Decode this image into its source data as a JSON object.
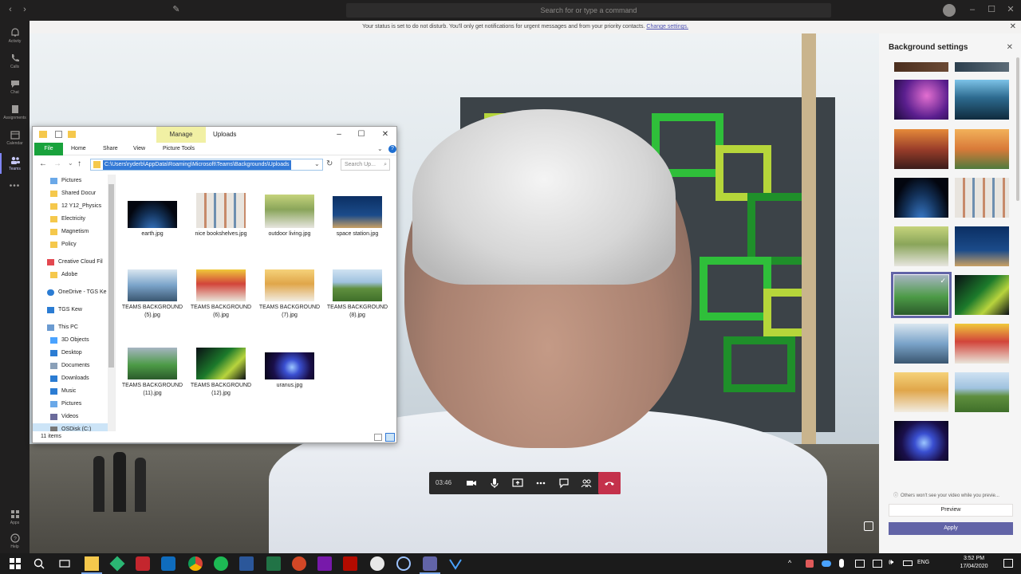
{
  "teams": {
    "search_placeholder": "Search for or type a command",
    "banner_text": "Your status is set to do not disturb. You'll only get notifications for urgent messages and from your priority contacts. ",
    "banner_link": "Change settings.",
    "rail": [
      {
        "label": "Activity",
        "icon": "bell-icon"
      },
      {
        "label": "Calls",
        "icon": "phone-icon"
      },
      {
        "label": "Chat",
        "icon": "chat-icon"
      },
      {
        "label": "Assignments",
        "icon": "assignments-icon"
      },
      {
        "label": "Calendar",
        "icon": "calendar-icon"
      },
      {
        "label": "Teams",
        "icon": "teams-icon"
      },
      {
        "label": "...",
        "icon": "more-icon"
      },
      {
        "label": "Apps",
        "icon": "apps-icon"
      },
      {
        "label": "Help",
        "icon": "help-icon"
      }
    ]
  },
  "call": {
    "timer": "03:46"
  },
  "bg_panel": {
    "title": "Background settings",
    "note": "Others won't see your video while you previe...",
    "preview_label": "Preview",
    "apply_label": "Apply",
    "accent": "#6264a7"
  },
  "explorer": {
    "manage_tab": "Manage",
    "window_title": "Uploads",
    "ribbon": {
      "file": "File",
      "home": "Home",
      "share": "Share",
      "view": "View",
      "picture_tools": "Picture Tools"
    },
    "address": "C:\\Users\\ryderb\\AppData\\Roaming\\Microsoft\\Teams\\Backgrounds\\Uploads",
    "search_placeholder": "Search Up...",
    "nav": [
      {
        "label": "Pictures",
        "type": "pictures"
      },
      {
        "label": "Shared Docur",
        "type": "folder"
      },
      {
        "label": "12 Y12_Physics",
        "type": "folder"
      },
      {
        "label": "Electricity",
        "type": "folder"
      },
      {
        "label": "Magnetism",
        "type": "folder"
      },
      {
        "label": "Policy",
        "type": "folder"
      },
      {
        "label": "Creative Cloud Fil",
        "type": "cc"
      },
      {
        "label": "Adobe",
        "type": "folder"
      },
      {
        "label": "OneDrive - TGS Ke",
        "type": "onedrive"
      },
      {
        "label": "TGS Kew",
        "type": "people"
      },
      {
        "label": "This PC",
        "type": "pc"
      },
      {
        "label": "3D Objects",
        "type": "3d"
      },
      {
        "label": "Desktop",
        "type": "desktop"
      },
      {
        "label": "Documents",
        "type": "docs"
      },
      {
        "label": "Downloads",
        "type": "downloads"
      },
      {
        "label": "Music",
        "type": "music"
      },
      {
        "label": "Pictures",
        "type": "pictures"
      },
      {
        "label": "Videos",
        "type": "videos"
      },
      {
        "label": "OSDisk (C:)",
        "type": "disk"
      }
    ],
    "files": [
      {
        "name": "earth.jpg"
      },
      {
        "name": "nice bookshelves.jpg"
      },
      {
        "name": "outdoor living.jpg"
      },
      {
        "name": "space station.jpg"
      },
      {
        "name": "TEAMS BACKGROUND (5).jpg"
      },
      {
        "name": "TEAMS BACKGROUND (6).jpg"
      },
      {
        "name": "TEAMS BACKGROUND (7).jpg"
      },
      {
        "name": "TEAMS BACKGROUND (8).jpg"
      },
      {
        "name": "TEAMS BACKGROUND (11).jpg"
      },
      {
        "name": "TEAMS BACKGROUND (12).jpg"
      },
      {
        "name": "uranus.jpg"
      }
    ],
    "status": "11 items"
  },
  "taskbar": {
    "lang": "ENG",
    "time": "3:52 PM",
    "date": "17/04/2020"
  }
}
